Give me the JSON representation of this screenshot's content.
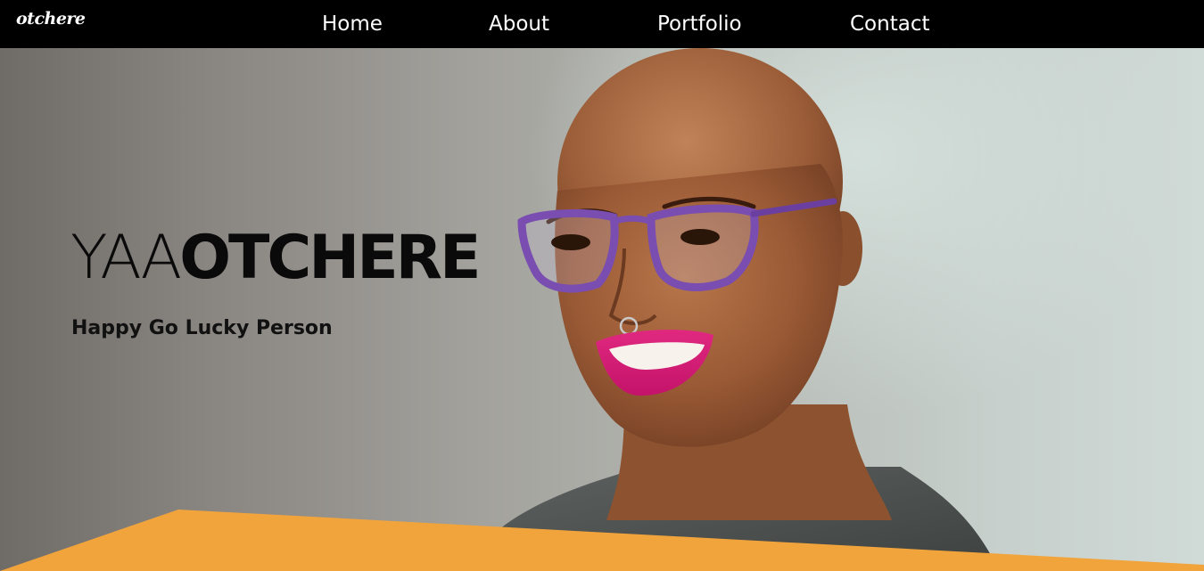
{
  "nav": {
    "logo": "otchere",
    "links": [
      {
        "label": "Home"
      },
      {
        "label": "About"
      },
      {
        "label": "Portfolio"
      },
      {
        "label": "Contact"
      }
    ]
  },
  "hero": {
    "name_first": "YAA",
    "name_last": "OTCHERE",
    "tagline": "Happy Go Lucky Person"
  },
  "colors": {
    "nav_background": "#000000",
    "accent": "#f2a43c",
    "text": "#0a0a0a"
  },
  "icons": {
    "logo": "otchere-wordmark"
  }
}
